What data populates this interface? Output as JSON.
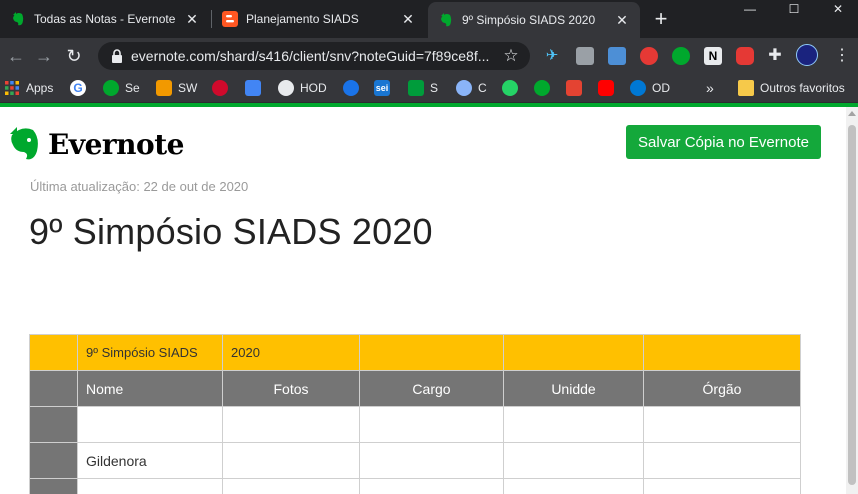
{
  "browser": {
    "tabs": [
      {
        "title": "Todas as Notas - Evernote",
        "favicon": "evernote-icon",
        "active": false
      },
      {
        "title": "Planejamento SIADS",
        "favicon": "blogger-icon",
        "active": false
      },
      {
        "title": "9º Simpósio SIADS 2020",
        "favicon": "evernote-icon",
        "active": true
      }
    ],
    "new_tab": "+",
    "window_controls": {
      "minimize": "—",
      "maximize": "☐",
      "close": "✕"
    },
    "url": "evernote.com/shard/s416/client/snv?noteGuid=7f89ce8f...",
    "bookmarks": [
      {
        "label": "Apps",
        "icon": "apps-grid-icon",
        "color": "#ea4335"
      },
      {
        "label": "",
        "icon": "google-icon",
        "color": "#4285f4"
      },
      {
        "label": "Se",
        "icon": "evernote-icon",
        "color": "#00a82d"
      },
      {
        "label": "SW",
        "icon": "sw-icon",
        "color": "#f29900"
      },
      {
        "label": "",
        "icon": "huawei-icon",
        "color": "#cf0a2c"
      },
      {
        "label": "",
        "icon": "translate-icon",
        "color": "#4285f4"
      },
      {
        "label": "HOD",
        "icon": "globe-icon",
        "color": "#e8eaed"
      },
      {
        "label": "",
        "icon": "sphere-icon",
        "color": "#1a73e8"
      },
      {
        "label": "",
        "icon": "sei-icon",
        "color": "#1976d2"
      },
      {
        "label": "S",
        "icon": "brazil-flag-icon",
        "color": "#009c3b"
      },
      {
        "label": "C",
        "icon": "cloud-c-icon",
        "color": "#8ab4f8"
      },
      {
        "label": "",
        "icon": "whatsapp-icon",
        "color": "#25d366"
      },
      {
        "label": "",
        "icon": "evernote-icon",
        "color": "#00a82d"
      },
      {
        "label": "",
        "icon": "todoist-icon",
        "color": "#e44332"
      },
      {
        "label": "",
        "icon": "youtube-icon",
        "color": "#ff0000"
      },
      {
        "label": "OD",
        "icon": "onedrive-icon",
        "color": "#0078d4"
      }
    ],
    "bookmarks_overflow": "»",
    "other_bookmarks": "Outros favoritos"
  },
  "evernote": {
    "brand": "Evernote",
    "save_button": "Salvar Cópia no Evernote",
    "last_updated": "Última atualização: 22 de out de 2020",
    "note_title": "9º Simpósio SIADS 2020",
    "brand_green": "#00a82d"
  },
  "table": {
    "top_row": [
      "9º Simpósio SIADS",
      "2020",
      "",
      "",
      ""
    ],
    "headers": [
      "Nome",
      "Fotos",
      "Cargo",
      "Unidde",
      "Órgão"
    ],
    "rows": [
      [
        "",
        "",
        "",
        "",
        ""
      ],
      [
        "Gildenora",
        "",
        "",
        "",
        ""
      ],
      [
        "",
        "",
        "",
        "",
        ""
      ]
    ],
    "colors": {
      "top_row": "#ffc000",
      "header": "#757575"
    }
  }
}
